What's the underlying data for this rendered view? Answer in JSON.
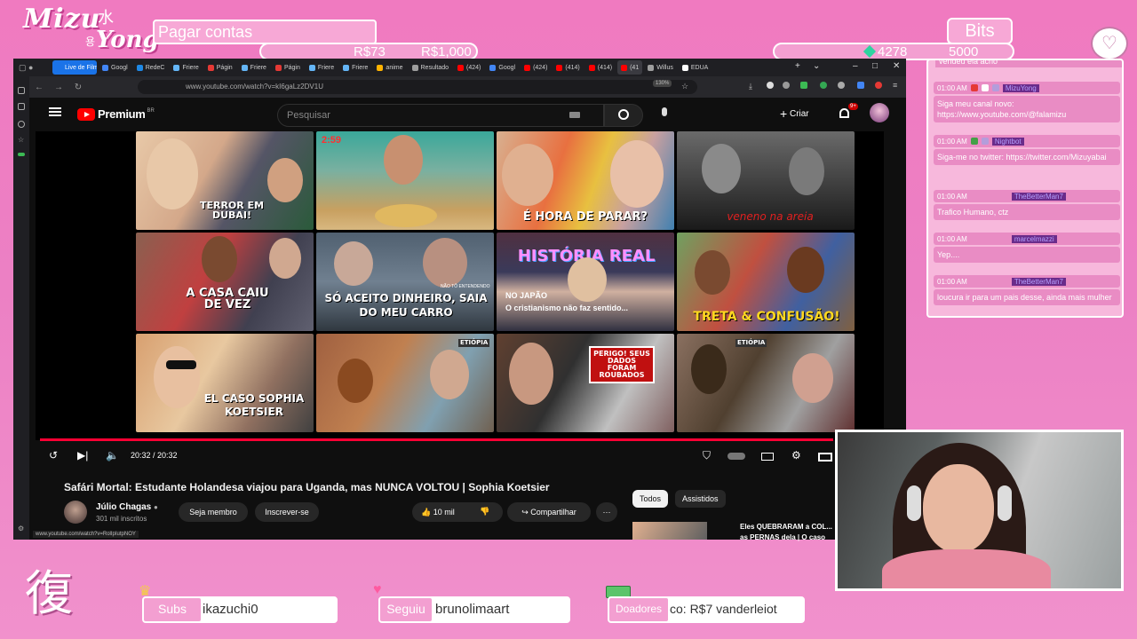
{
  "overlay": {
    "logo_main": "Mizu",
    "logo_kanji": "水",
    "logo_sub": "Yong",
    "logo_kanji2": "용",
    "goal_title": "Pagar contas",
    "goal_current": "R$73",
    "goal_target": "R$1,000",
    "bits_title": "Bits",
    "bits_current": "4278",
    "bits_target": "5000",
    "bottom_kanji": "復",
    "subs_label": "Subs",
    "subs_value": "ikazuchi0",
    "follow_label": "Seguiu",
    "follow_value": "brunolimaart",
    "donors_label": "Doadores",
    "donors_value": "co: R$7    vanderleiot"
  },
  "browser": {
    "tabs": [
      {
        "label": "Live de Filmes",
        "color": "#1a73e8"
      },
      {
        "label": "Googl",
        "color": "#4285f4"
      },
      {
        "label": "RedeC",
        "color": "#1e88e5"
      },
      {
        "label": "Friere",
        "color": "#64b5f6"
      },
      {
        "label": "Págin",
        "color": "#e53935"
      },
      {
        "label": "Friere",
        "color": "#64b5f6"
      },
      {
        "label": "Págin",
        "color": "#e53935"
      },
      {
        "label": "Friere",
        "color": "#64b5f6"
      },
      {
        "label": "Friere",
        "color": "#64b5f6"
      },
      {
        "label": "anime",
        "color": "#ffb300"
      },
      {
        "label": "Resultado",
        "color": "#9e9e9e"
      },
      {
        "label": "(424)",
        "color": "#ff0000"
      },
      {
        "label": "Googl",
        "color": "#4285f4"
      },
      {
        "label": "(424)",
        "color": "#ff0000"
      },
      {
        "label": "(414)",
        "color": "#ff0000"
      },
      {
        "label": "(414)",
        "color": "#ff0000"
      },
      {
        "label": "(41",
        "color": "#ff0000"
      },
      {
        "label": "Willus",
        "color": "#9e9e9e"
      },
      {
        "label": "EDUA",
        "color": "#fff"
      }
    ],
    "url": "www.youtube.com/watch?v=kI6gaLz2DV1U",
    "zoom": "130%",
    "status_url": "www.youtube.com/watch?v=RolIpIutpNOY"
  },
  "youtube": {
    "brand": "Premium",
    "region": "BR",
    "search_placeholder": "Pesquisar",
    "create_label": "Criar",
    "notif_count": "9+",
    "thumbnails": [
      "TERROR EM DUBAI!",
      "",
      "É HORA DE PARAR?",
      "veneno na areia",
      "A CASA CAIU DE VEZ",
      "SÓ ACEITO DINHEIRO, SAIA DO MEU CARRO",
      "HISTÓRIA REAL",
      "TRETA & CONFUSÃO!",
      "EL CASO SOPHIA KOETSIER",
      "ETIÓPIA",
      "PERIGO! SEUS DADOS FORAM ROUBADOS",
      "ETIÓPIA"
    ],
    "thumb_sub1": "NÃO TÔ ENTENDENDO",
    "thumb_sub_japan1": "NO JAPÃO",
    "thumb_sub_japan2": "O cristianismo não faz sentido...",
    "thumb_timer": "2:59",
    "time_display": "20:32 / 20:32",
    "progress": 1.0,
    "video_title": "Safári Mortal: Estudante Holandesa viajou para Uganda, mas NUNCA VOLTOU | Sophia Koetsier",
    "channel_name": "Júlio Chagas",
    "channel_subs": "301 mil inscritos",
    "join_label": "Seja membro",
    "subscribe_label": "Inscrever-se",
    "likes": "10 mil",
    "share_label": "Compartilhar",
    "related_tabs": [
      "Todos",
      "Assistidos"
    ],
    "related_title": "Eles QUEBRARAM a COL... as PERNAS dela | O caso"
  },
  "chat": {
    "top_fragment": "vendeu ela acho",
    "messages": [
      {
        "time": "01:00 AM",
        "user": "MizuYong",
        "text": "Siga meu canal novo: https://www.youtube.com/@falamizu"
      },
      {
        "time": "01:00 AM",
        "user": "Nightbot",
        "text": "Siga-me no twitter: https://twitter.com/Mizuyabai"
      },
      {
        "time": "01:00 AM",
        "user": "TheBetterMan7",
        "text": "Trafico Humano, ctz"
      },
      {
        "time": "01:00 AM",
        "user": "marcelmazzi",
        "text": "Yep...."
      },
      {
        "time": "01:00 AM",
        "user": "TheBetterMan7",
        "text": "loucura ir para um pais desse, ainda mais mulher"
      }
    ]
  },
  "colors": {
    "background": "#f07ac0",
    "accent_red": "#ff0033",
    "chat_bg": "#f7b8dc"
  }
}
